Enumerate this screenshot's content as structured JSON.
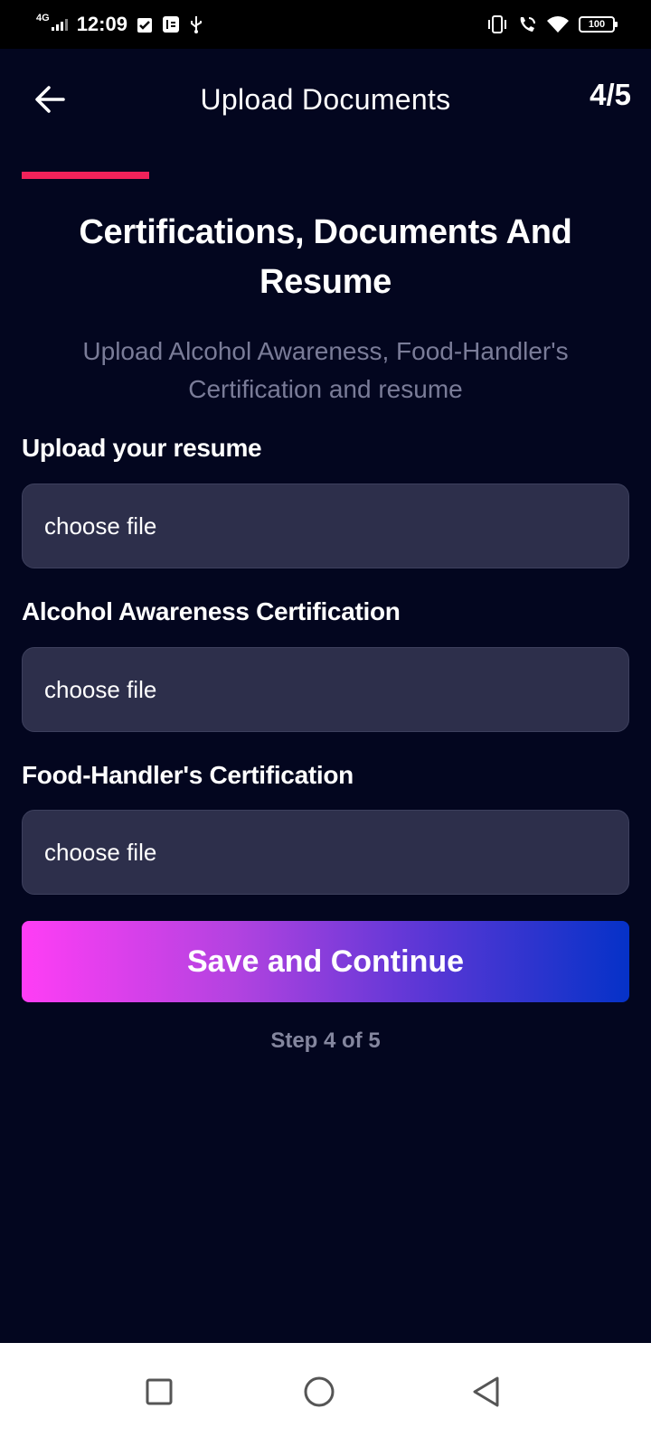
{
  "status_bar": {
    "network": "4G",
    "time": "12:09",
    "battery": "100",
    "icons": [
      "signal-icon",
      "checkbox-notification-icon",
      "debug-icon",
      "usb-icon",
      "vibrate-icon",
      "wifi-call-icon",
      "wifi-icon",
      "battery-icon"
    ]
  },
  "header": {
    "title": "Upload Documents",
    "step_counter": "4/5",
    "back_icon": "arrow-left-icon"
  },
  "progress": {
    "current_step": 4,
    "total_steps": 5,
    "fill_fraction": 0.21,
    "color": "#f0225a"
  },
  "section": {
    "title": "Certifications, Documents And Resume",
    "subtitle": "Upload Alcohol Awareness, Food-Handler's Certification and resume"
  },
  "fields": [
    {
      "label": "Upload your resume",
      "value": "choose file"
    },
    {
      "label": "Alcohol Awareness Certification",
      "value": "choose file"
    },
    {
      "label": "Food-Handler's Certification",
      "value": "choose file"
    }
  ],
  "actions": {
    "save_label": "Save and Continue",
    "step_text": "Step 4 of 5"
  },
  "colors": {
    "background": "#03061f",
    "input_bg": "#2d2f4b",
    "gradient_start": "#ff3df5",
    "gradient_end": "#0532c8",
    "muted_text": "#7a7c98"
  },
  "nav_bar": {
    "icons": [
      "recents-square-icon",
      "home-circle-icon",
      "back-triangle-icon"
    ]
  }
}
